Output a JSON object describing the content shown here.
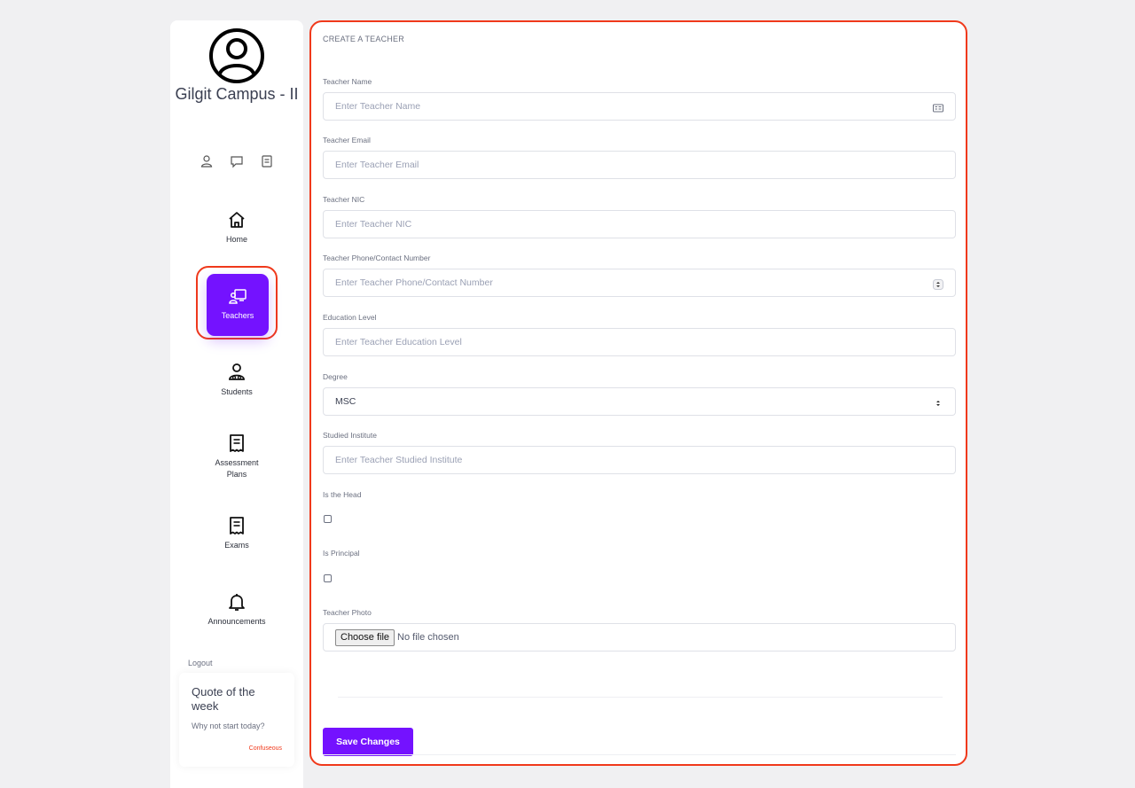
{
  "sidebar": {
    "campus_name": "Gilgit Campus - II",
    "quick_icons": [
      "user-icon",
      "chat-icon",
      "document-icon"
    ],
    "nav": [
      {
        "label": "Home",
        "icon": "home-icon",
        "active": false
      },
      {
        "label": "Teachers",
        "icon": "teacher-icon",
        "active": true
      },
      {
        "label": "Students",
        "icon": "student-icon",
        "active": false
      },
      {
        "label": "Assessment Plans",
        "icon": "receipt-icon",
        "active": false
      },
      {
        "label": "Exams",
        "icon": "receipt-icon",
        "active": false
      },
      {
        "label": "Announcements",
        "icon": "bell-icon",
        "active": false
      }
    ],
    "logout_label": "Logout",
    "quote": {
      "title": "Quote of the week",
      "text": "Why not start today?",
      "author": "Confuseous"
    }
  },
  "form": {
    "heading": "CREATE A TEACHER",
    "fields": {
      "name": {
        "label": "Teacher Name",
        "placeholder": "Enter Teacher Name"
      },
      "email": {
        "label": "Teacher Email",
        "placeholder": "Enter Teacher Email"
      },
      "nic": {
        "label": "Teacher NIC",
        "placeholder": "Enter Teacher NIC"
      },
      "phone": {
        "label": "Teacher Phone/Contact Number",
        "placeholder": "Enter Teacher Phone/Contact Number"
      },
      "education": {
        "label": "Education Level",
        "placeholder": "Enter Teacher Education Level"
      },
      "degree": {
        "label": "Degree",
        "value": "MSC"
      },
      "institute": {
        "label": "Studied Institute",
        "placeholder": "Enter Teacher Studied Institute"
      },
      "is_head": {
        "label": "Is the Head",
        "checked": false
      },
      "is_principal": {
        "label": "Is Principal",
        "checked": false
      },
      "photo": {
        "label": "Teacher Photo",
        "button": "Choose file",
        "status": "No file chosen"
      }
    },
    "save_label": "Save Changes"
  },
  "colors": {
    "accent": "#7412ff",
    "highlight": "#f0391b"
  }
}
